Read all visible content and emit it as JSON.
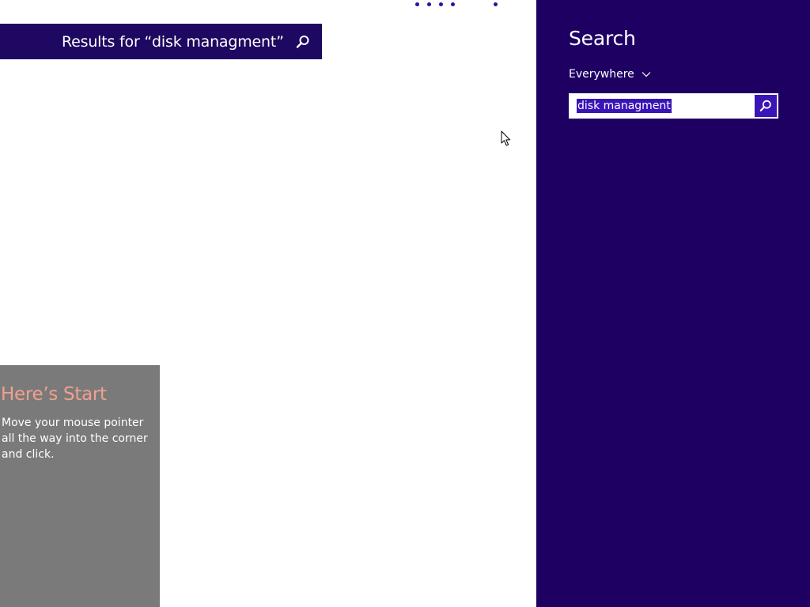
{
  "results": {
    "title": "Results for “disk managment”",
    "search_icon": "search-icon"
  },
  "progress": {
    "dot_count": 5,
    "dot_color": "#2d0fa0"
  },
  "tip": {
    "title": "Here’s Start",
    "body": "Move your mouse pointer all the way into the corner and click.",
    "title_color": "#f0a090",
    "background": "#7a7a7a"
  },
  "charm": {
    "title": "Search",
    "scope": {
      "selected": "Everywhere",
      "icon": "chevron-down-icon"
    },
    "query": {
      "value": "disk managment",
      "selected": true
    },
    "search_button_icon": "search-icon",
    "background": "#1e0063",
    "accent": "#3a14b6"
  },
  "colors": {
    "header_bar": "#1e0861",
    "page_background": "#ffffff"
  }
}
